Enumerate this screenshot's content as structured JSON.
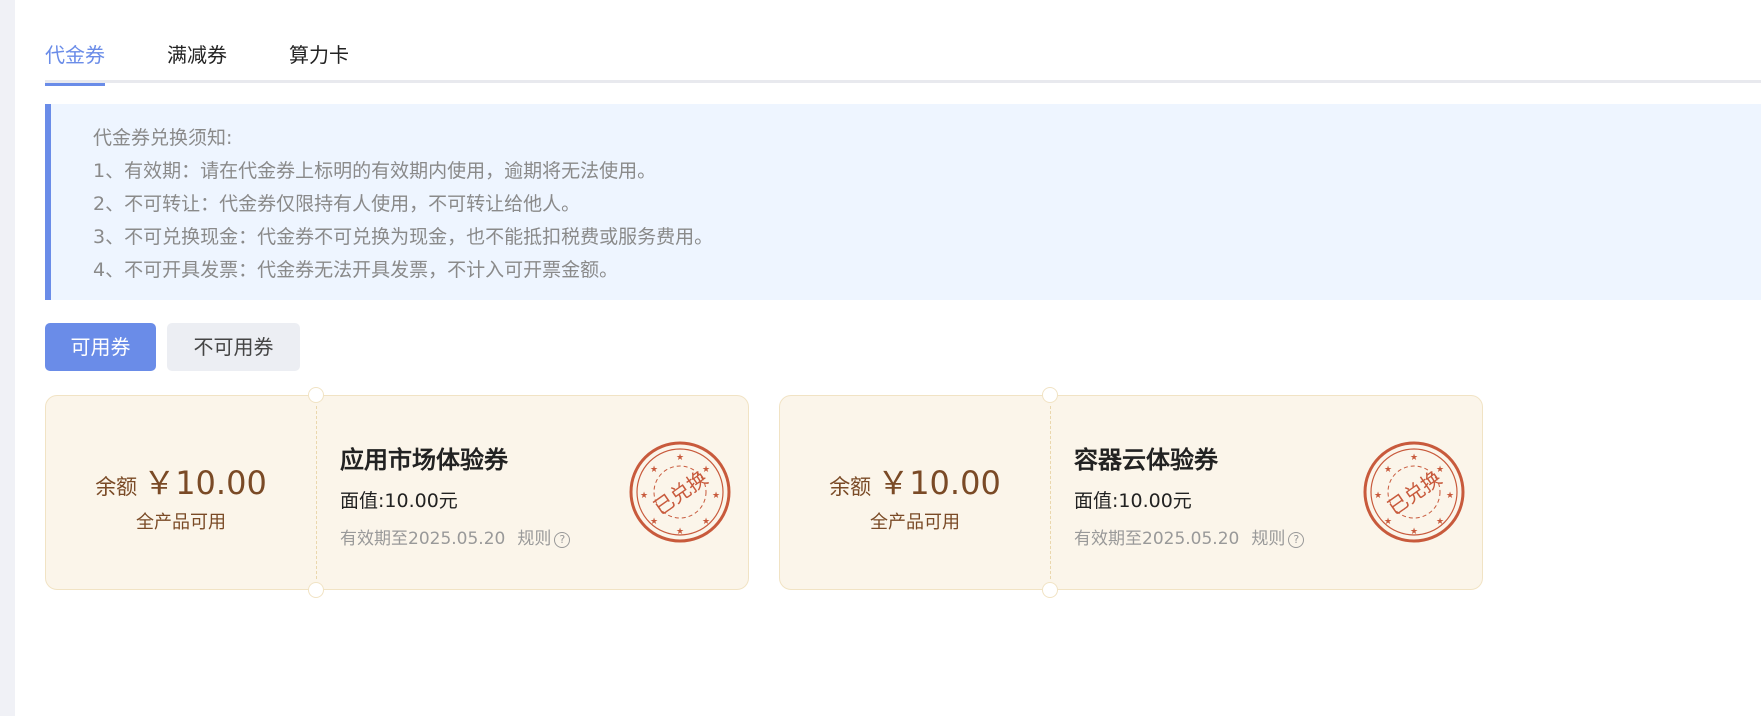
{
  "tabs": [
    {
      "label": "代金券",
      "active": true
    },
    {
      "label": "满减券",
      "active": false
    },
    {
      "label": "算力卡",
      "active": false
    }
  ],
  "notice": {
    "lines": [
      "代金券兑换须知:",
      "1、有效期：请在代金券上标明的有效期内使用，逾期将无法使用。",
      "2、不可转让：代金券仅限持有人使用，不可转让给他人。",
      "3、不可兑换现金：代金券不可兑换为现金，也不能抵扣税费或服务费用。",
      "4、不可开具发票：代金券无法开具发票，不计入可开票金额。"
    ]
  },
  "filter": {
    "available": "可用券",
    "unavailable": "不可用券"
  },
  "coupons": [
    {
      "balance_label": "余额",
      "balance_amount": "￥10.00",
      "scope": "全产品可用",
      "title": "应用市场体验券",
      "face_value": "面值:10.00元",
      "validity": "有效期至2025.05.20",
      "rule_label": "规则",
      "stamp_text": "已兑换"
    },
    {
      "balance_label": "余额",
      "balance_amount": "￥10.00",
      "scope": "全产品可用",
      "title": "容器云体验券",
      "face_value": "面值:10.00元",
      "validity": "有效期至2025.05.20",
      "rule_label": "规则",
      "stamp_text": "已兑换"
    }
  ],
  "colors": {
    "accent": "#6a8ce8",
    "stamp": "#c85a3c",
    "coupon_bg": "#fbf5ea"
  }
}
